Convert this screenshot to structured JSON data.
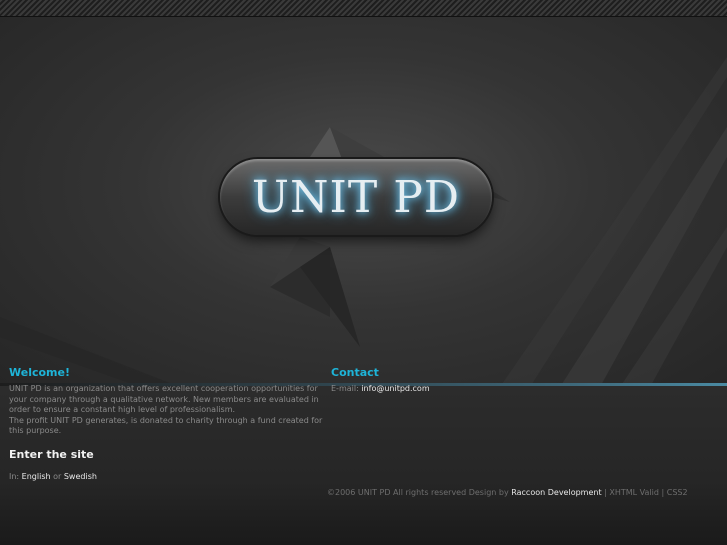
{
  "logo": {
    "text": "UNIT PD"
  },
  "welcome": {
    "title": "Welcome!",
    "paragraph1": "UNIT PD is an organization that offers excellent cooperation opportunities for your company through a qualitative network. New members are evaluated in order to ensure a constant high level of professionalism.",
    "paragraph2": "The profit UNIT PD generates, is donated to charity through a fund created for this purpose."
  },
  "contact": {
    "title": "Contact",
    "email_label": "E-mail:",
    "email": "info@unitpd.com"
  },
  "enter": {
    "title": "Enter the site",
    "in_label": "In:",
    "english": "English",
    "or": "or",
    "swedish": "Swedish"
  },
  "footer": {
    "copyright": "©2006 UNIT PD All rights reserved Design by",
    "designer": "Raccoon Development",
    "sep1": "|",
    "xhtml": "XHTML Valid",
    "sep2": "|",
    "css": "CSS2"
  },
  "colors": {
    "accent": "#1eb4d8",
    "background": "#2b2b2b",
    "text": "#8a8a8a",
    "link": "#e8e8e8"
  }
}
